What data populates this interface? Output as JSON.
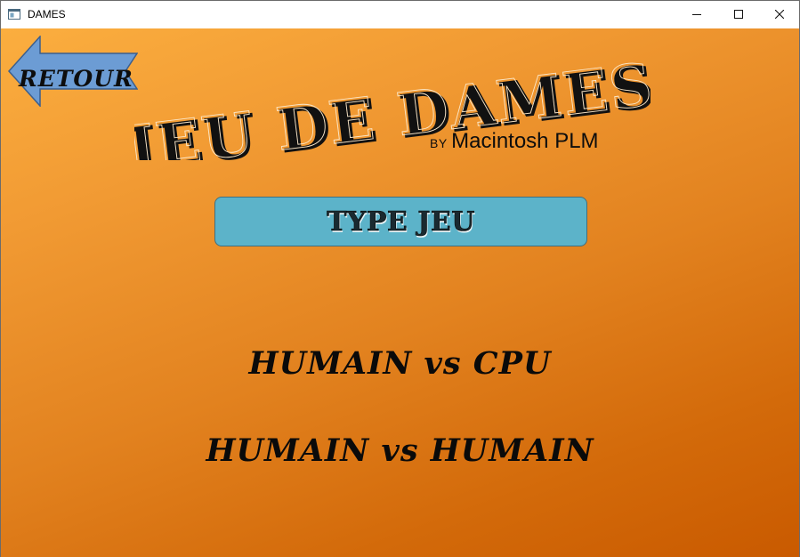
{
  "window": {
    "title": "DAMES",
    "controls": [
      "minimize",
      "maximize",
      "close"
    ]
  },
  "back": {
    "label": "RETOUR",
    "color": "#6c9cd4"
  },
  "header": {
    "title": "JEU DE DAMES",
    "byline_prefix": "BY",
    "author": "Macintosh PLM"
  },
  "section": {
    "label": "TYPE JEU",
    "color": "#5cb3c9"
  },
  "modes": [
    {
      "label": "HUMAIN vs CPU"
    },
    {
      "label": "HUMAIN vs HUMAIN"
    }
  ],
  "theme": {
    "gradient_start": "#fbae3f",
    "gradient_end": "#c95a00"
  }
}
